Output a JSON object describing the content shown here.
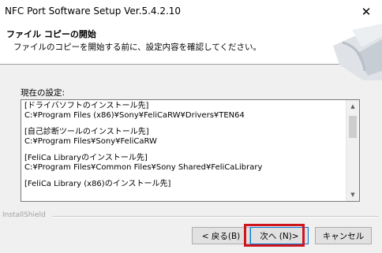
{
  "window": {
    "title": "NFC Port Software Setup  Ver.5.4.2.10",
    "close_glyph": "✕"
  },
  "header": {
    "title": "ファイル コピーの開始",
    "subtitle": "ファイルのコピーを開始する前に、設定内容を確認してください。"
  },
  "content": {
    "label": "現在の設定:",
    "entries": [
      {
        "heading": "[ドライバソフトのインストール先]",
        "path": "C:¥Program Files (x86)¥Sony¥FeliCaRW¥Drivers¥TEN64"
      },
      {
        "heading": "[自己診断ツールのインストール先]",
        "path": "C:¥Program Files¥Sony¥FeliCaRW"
      },
      {
        "heading": "[FeliCa Libraryのインストール先]",
        "path": "C:¥Program Files¥Common Files¥Sony Shared¥FeliCaLibrary"
      },
      {
        "heading": "[FeliCa Library (x86)のインストール先]",
        "path": ""
      }
    ],
    "scroll_up_glyph": "▲",
    "scroll_down_glyph": "▼"
  },
  "footer": {
    "installshield": "InstallShield",
    "back_label": "< 戻る(B)",
    "next_label": "次へ (N)>",
    "cancel_label": "キャンセル"
  },
  "colors": {
    "highlight": "#d0161d",
    "default_button_border": "#0078d7"
  },
  "icons": {
    "close": "close-icon",
    "logo": "installshield-logo",
    "scroll_up": "arrow-up-icon",
    "scroll_down": "arrow-down-icon"
  }
}
